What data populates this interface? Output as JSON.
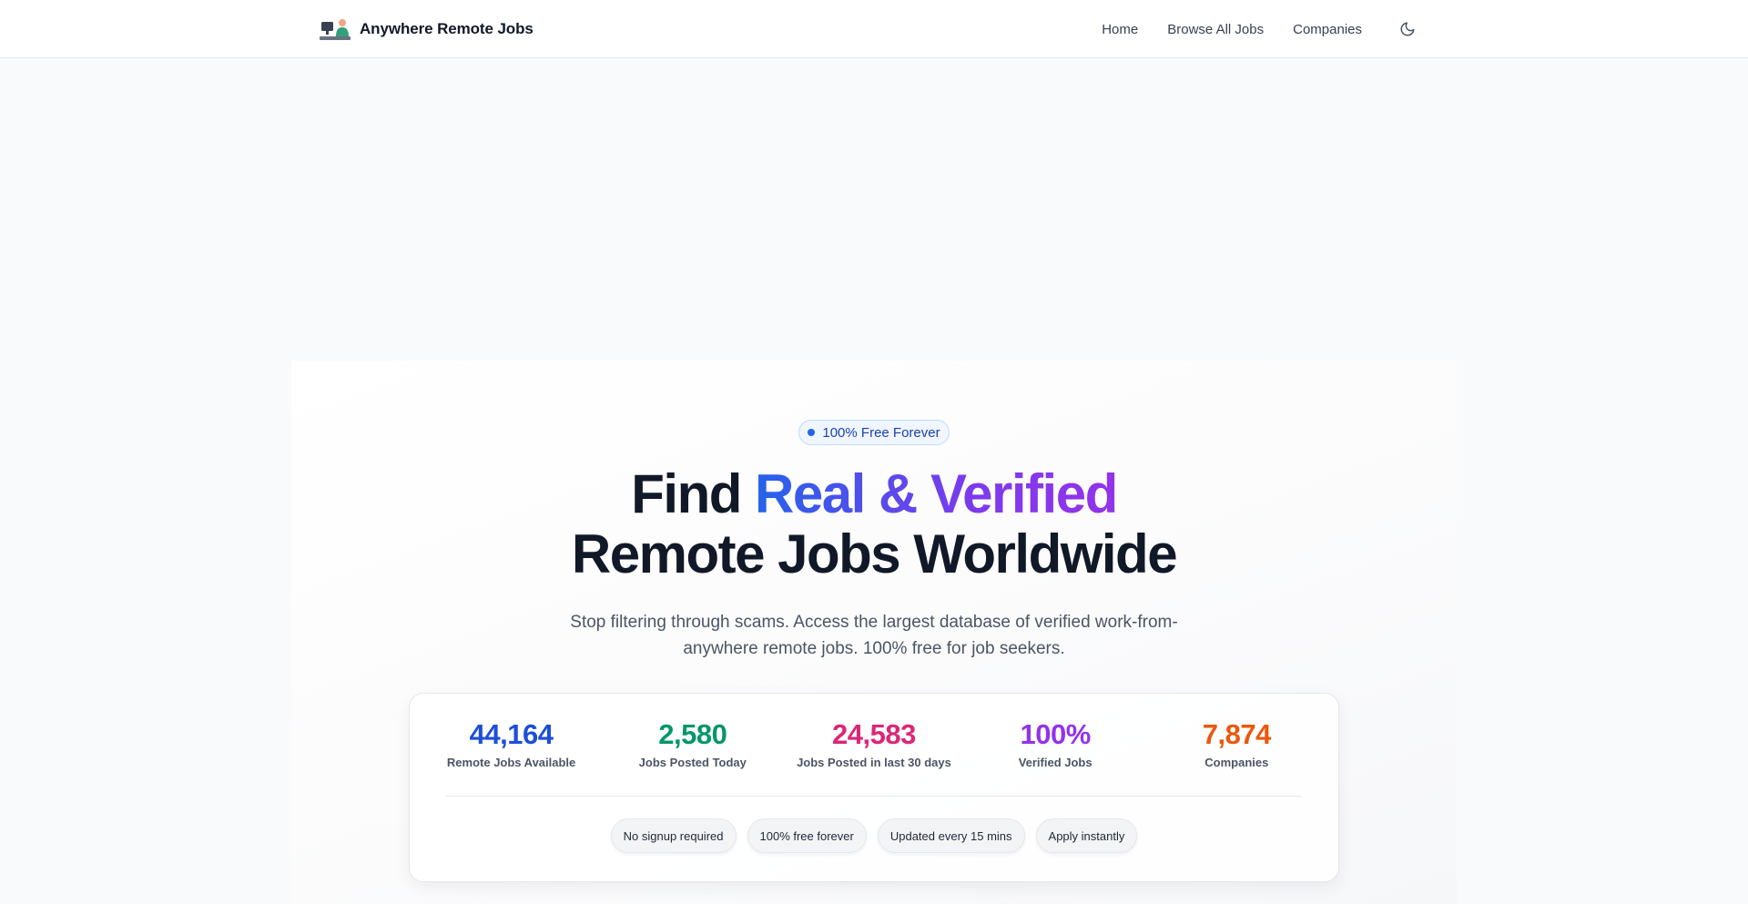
{
  "header": {
    "brand": "Anywhere Remote Jobs",
    "nav": [
      "Home",
      "Browse All Jobs",
      "Companies"
    ]
  },
  "hero": {
    "badge": "100% Free Forever",
    "headline_part1": "Find ",
    "headline_highlight": "Real & Verified",
    "headline_line2": "Remote Jobs Worldwide",
    "subtext": "Stop filtering through scams. Access the largest database of verified work-from-anywhere remote jobs. 100% free for job seekers."
  },
  "stats": [
    {
      "value": "44,164",
      "label": "Remote Jobs Available",
      "color": "#1d4ed8"
    },
    {
      "value": "2,580",
      "label": "Jobs Posted Today",
      "color": "#059669"
    },
    {
      "value": "24,583",
      "label": "Jobs Posted in last 30 days",
      "color": "#db2777"
    },
    {
      "value": "100%",
      "label": "Verified Jobs",
      "color": "#9333ea"
    },
    {
      "value": "7,874",
      "label": "Companies",
      "color": "#ea580c"
    }
  ],
  "features": [
    "No signup required",
    "100% free forever",
    "Updated every 15 mins",
    "Apply instantly"
  ],
  "icons": {
    "logo": "remote-worker-logo-icon",
    "theme": "moon-icon",
    "badge_dot": "dot-icon"
  }
}
